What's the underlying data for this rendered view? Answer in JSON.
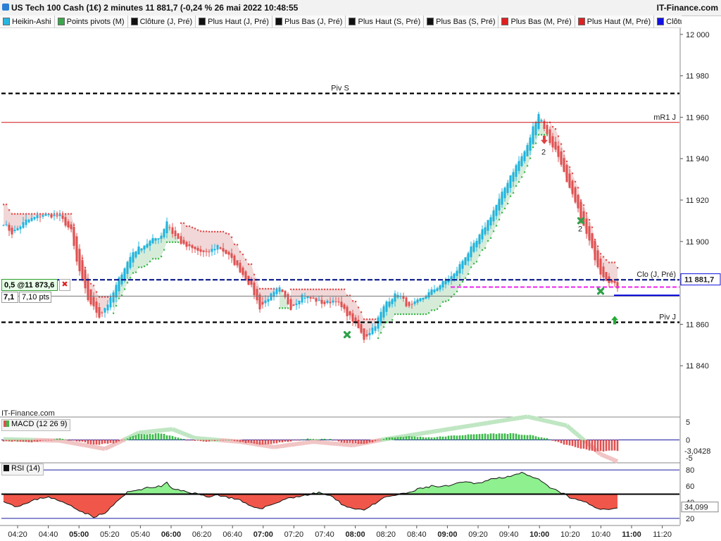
{
  "window": {
    "title": "US Tech 100 Cash (1€) 2 minutes 11 881,7 (-0,24 % 26 mai 2022 10:48:55",
    "brand": "IT-Finance.com",
    "brand_small": "IT-Finance.com"
  },
  "legend": [
    {
      "label": "Heikin-Ashi",
      "color": "#29b6e0"
    },
    {
      "label": "Points pivots (M)",
      "color": "#3aa84a"
    },
    {
      "label": "Clôture (J, Pré)",
      "color": "#111111"
    },
    {
      "label": "Plus Haut (J, Pré)",
      "color": "#111111"
    },
    {
      "label": "Plus Bas (J, Pré)",
      "color": "#111111"
    },
    {
      "label": "Plus Haut (S, Pré)",
      "color": "#111111"
    },
    {
      "label": "Plus Bas (S, Pré)",
      "color": "#111111"
    },
    {
      "label": "Plus Bas (M, Pré)",
      "color": "#e02020"
    },
    {
      "label": "Plus Haut (M, Pré)",
      "color": "#e02020"
    },
    {
      "label": "Clôture (J)",
      "color": "#1010e0"
    }
  ],
  "order_box": {
    "order_label": "0,5 @11 873,6",
    "close_symbol": "✖",
    "qty": "7,1",
    "pts": "7,10 pts"
  },
  "indicators": {
    "macd_title": "MACD (12 26 9)",
    "rsi_title": "RSI (14)"
  },
  "colors": {
    "up": "#1fb3e0",
    "down": "#e05050",
    "up_cloud": "#cfe9d2",
    "down_cloud": "#efd0d0",
    "dot_up": "#3cb84a",
    "dot_down": "#e05050",
    "pivot": "#000000",
    "mr1": "#d01010",
    "close_prev": "#0a1a8a",
    "close_day": "#0000dd",
    "magenta": "#ee22ee",
    "rsi_green": "#8ef08e",
    "rsi_red": "#f0574a"
  },
  "chart_data": [
    {
      "type": "candlestick",
      "title": "US Tech 100 Cash (1€) 2 minutes",
      "price_ylim": [
        11820,
        12003
      ],
      "x_ticks": [
        "04:20",
        "04:40",
        "05:00",
        "05:20",
        "05:40",
        "06:00",
        "06:20",
        "06:40",
        "07:00",
        "07:20",
        "07:40",
        "08:00",
        "08:20",
        "08:40",
        "09:00",
        "09:20",
        "09:40",
        "10:00",
        "10:20",
        "10:40",
        "11:00",
        "11:20"
      ],
      "x_ticks_bold": [
        "05:00",
        "06:00",
        "07:00",
        "08:00",
        "09:00",
        "10:00",
        "11:00"
      ],
      "y_ticks": [
        "12 000",
        "11 980",
        "11 960",
        "11 940",
        "11 920",
        "11 900",
        "11 880",
        "11 860",
        "11 840"
      ],
      "y_tick_values": [
        12000,
        11980,
        11960,
        11940,
        11920,
        11900,
        11880,
        11860,
        11840
      ],
      "last_price_label": "11 881,7",
      "last_price": 11881.7,
      "levels": [
        {
          "label": "Piv S",
          "value": 11971.5,
          "style": "pivot"
        },
        {
          "label": "mR1 J",
          "value": 11957.5,
          "style": "mr1"
        },
        {
          "label": "Clo (J, Pré)",
          "value": 11881.5,
          "style": "close_prev"
        },
        {
          "label": "",
          "value": 11878.0,
          "style": "magenta"
        },
        {
          "label": "",
          "value": 11873.6,
          "style": "order"
        },
        {
          "label": "",
          "value": 11874.0,
          "style": "close_day"
        },
        {
          "label": "Piv J",
          "value": 11861.0,
          "style": "pivot"
        }
      ],
      "close_path_knots": [
        [
          0,
          11909
        ],
        [
          3,
          11904
        ],
        [
          8,
          11910
        ],
        [
          14,
          11913
        ],
        [
          20,
          11912
        ],
        [
          24,
          11905
        ],
        [
          26,
          11890
        ],
        [
          30,
          11872
        ],
        [
          34,
          11864
        ],
        [
          38,
          11872
        ],
        [
          42,
          11885
        ],
        [
          46,
          11895
        ],
        [
          52,
          11900
        ],
        [
          56,
          11903
        ],
        [
          58,
          11910
        ],
        [
          60,
          11904
        ],
        [
          64,
          11898
        ],
        [
          68,
          11896
        ],
        [
          72,
          11894
        ],
        [
          76,
          11898
        ],
        [
          80,
          11893
        ],
        [
          84,
          11886
        ],
        [
          88,
          11878
        ],
        [
          91,
          11868
        ],
        [
          94,
          11873
        ],
        [
          98,
          11877
        ],
        [
          102,
          11868
        ],
        [
          106,
          11874
        ],
        [
          110,
          11872
        ],
        [
          114,
          11870
        ],
        [
          118,
          11872
        ],
        [
          120,
          11868
        ],
        [
          124,
          11862
        ],
        [
          126,
          11858
        ],
        [
          128,
          11853
        ],
        [
          132,
          11860
        ],
        [
          136,
          11871
        ],
        [
          140,
          11875
        ],
        [
          144,
          11868
        ],
        [
          148,
          11872
        ],
        [
          152,
          11876
        ],
        [
          156,
          11880
        ],
        [
          160,
          11884
        ],
        [
          164,
          11893
        ],
        [
          168,
          11900
        ],
        [
          172,
          11910
        ],
        [
          176,
          11920
        ],
        [
          180,
          11932
        ],
        [
          184,
          11941
        ],
        [
          186,
          11946
        ],
        [
          188,
          11955
        ],
        [
          190,
          11962
        ],
        [
          192,
          11955
        ],
        [
          194,
          11948
        ],
        [
          196,
          11944
        ],
        [
          198,
          11938
        ],
        [
          200,
          11928
        ],
        [
          202,
          11922
        ],
        [
          204,
          11915
        ],
        [
          206,
          11907
        ],
        [
          208,
          11900
        ],
        [
          210,
          11892
        ],
        [
          212,
          11885
        ],
        [
          214,
          11882
        ],
        [
          216,
          11880
        ],
        [
          218,
          11878
        ]
      ],
      "markers": [
        {
          "type": "down_arrow",
          "bar": 192,
          "value": 11947,
          "label": "2"
        },
        {
          "type": "cross",
          "bar": 205,
          "value": 11910,
          "label": "2"
        },
        {
          "type": "cross",
          "bar": 122,
          "value": 11855,
          "label": ""
        },
        {
          "type": "cross",
          "bar": 212,
          "value": 11876,
          "label": ""
        },
        {
          "type": "up_arrow",
          "bar": 217,
          "value": 11862,
          "label": ""
        }
      ]
    },
    {
      "type": "bar",
      "title": "MACD (12 26 9)",
      "ylim": [
        -6,
        6
      ],
      "y_ticks": [
        "5",
        "0",
        "-5"
      ],
      "y_tick_values": [
        5,
        0,
        -5
      ],
      "last_value_label": "-3,0428",
      "last_value": -3.0428,
      "histogram_knots": [
        [
          0,
          -0.3
        ],
        [
          10,
          -0.6
        ],
        [
          20,
          0.4
        ],
        [
          28,
          -0.5
        ],
        [
          32,
          -1.4
        ],
        [
          40,
          -0.8
        ],
        [
          44,
          0.5
        ],
        [
          48,
          1.5
        ],
        [
          56,
          1.8
        ],
        [
          62,
          0.6
        ],
        [
          66,
          -0.2
        ],
        [
          72,
          -0.4
        ],
        [
          80,
          0.1
        ],
        [
          84,
          -0.6
        ],
        [
          92,
          -1.4
        ],
        [
          100,
          -0.6
        ],
        [
          108,
          0.3
        ],
        [
          116,
          0.2
        ],
        [
          120,
          -0.6
        ],
        [
          128,
          -1.2
        ],
        [
          132,
          -0.4
        ],
        [
          136,
          0.6
        ],
        [
          144,
          1.0
        ],
        [
          152,
          0.7
        ],
        [
          160,
          1.2
        ],
        [
          170,
          1.7
        ],
        [
          180,
          1.8
        ],
        [
          188,
          1.2
        ],
        [
          194,
          0.2
        ],
        [
          198,
          -1.0
        ],
        [
          204,
          -2.2
        ],
        [
          210,
          -3.2
        ],
        [
          218,
          -3.0
        ]
      ],
      "signal_knots": [
        [
          0,
          0.2
        ],
        [
          20,
          -0.2
        ],
        [
          36,
          -2.5
        ],
        [
          48,
          2.0
        ],
        [
          60,
          3.0
        ],
        [
          68,
          0.5
        ],
        [
          84,
          -0.5
        ],
        [
          96,
          -2.0
        ],
        [
          110,
          -0.5
        ],
        [
          124,
          -1.5
        ],
        [
          134,
          0.0
        ],
        [
          150,
          2.0
        ],
        [
          170,
          4.5
        ],
        [
          186,
          6.5
        ],
        [
          200,
          4.0
        ],
        [
          212,
          -4.0
        ],
        [
          218,
          -6.0
        ]
      ]
    },
    {
      "type": "area",
      "title": "RSI (14)",
      "ylim": [
        12,
        88
      ],
      "y_ticks": [
        "80",
        "60",
        "40",
        "20"
      ],
      "y_tick_values": [
        80,
        60,
        40,
        20
      ],
      "baseline": 50,
      "upper_band": 80,
      "lower_band": 20,
      "last_value_label": "34,099",
      "last_value": 34.099,
      "rsi_knots": [
        [
          0,
          42
        ],
        [
          4,
          35
        ],
        [
          8,
          38
        ],
        [
          12,
          44
        ],
        [
          16,
          47
        ],
        [
          20,
          41
        ],
        [
          24,
          36
        ],
        [
          28,
          28
        ],
        [
          32,
          22
        ],
        [
          36,
          26
        ],
        [
          40,
          40
        ],
        [
          44,
          52
        ],
        [
          48,
          56
        ],
        [
          52,
          58
        ],
        [
          56,
          60
        ],
        [
          58,
          64
        ],
        [
          60,
          56
        ],
        [
          64,
          54
        ],
        [
          68,
          51
        ],
        [
          72,
          47
        ],
        [
          76,
          49
        ],
        [
          80,
          46
        ],
        [
          84,
          42
        ],
        [
          88,
          34
        ],
        [
          92,
          33
        ],
        [
          96,
          38
        ],
        [
          100,
          44
        ],
        [
          104,
          47
        ],
        [
          108,
          49
        ],
        [
          112,
          52
        ],
        [
          116,
          48
        ],
        [
          120,
          38
        ],
        [
          124,
          32
        ],
        [
          128,
          31
        ],
        [
          132,
          38
        ],
        [
          136,
          47
        ],
        [
          140,
          49
        ],
        [
          144,
          52
        ],
        [
          148,
          57
        ],
        [
          152,
          60
        ],
        [
          156,
          59
        ],
        [
          160,
          62
        ],
        [
          164,
          65
        ],
        [
          168,
          63
        ],
        [
          172,
          68
        ],
        [
          176,
          70
        ],
        [
          180,
          73
        ],
        [
          184,
          76
        ],
        [
          188,
          70
        ],
        [
          190,
          68
        ],
        [
          194,
          58
        ],
        [
          198,
          52
        ],
        [
          202,
          44
        ],
        [
          206,
          41
        ],
        [
          210,
          34
        ],
        [
          214,
          30
        ],
        [
          218,
          34
        ]
      ]
    }
  ]
}
